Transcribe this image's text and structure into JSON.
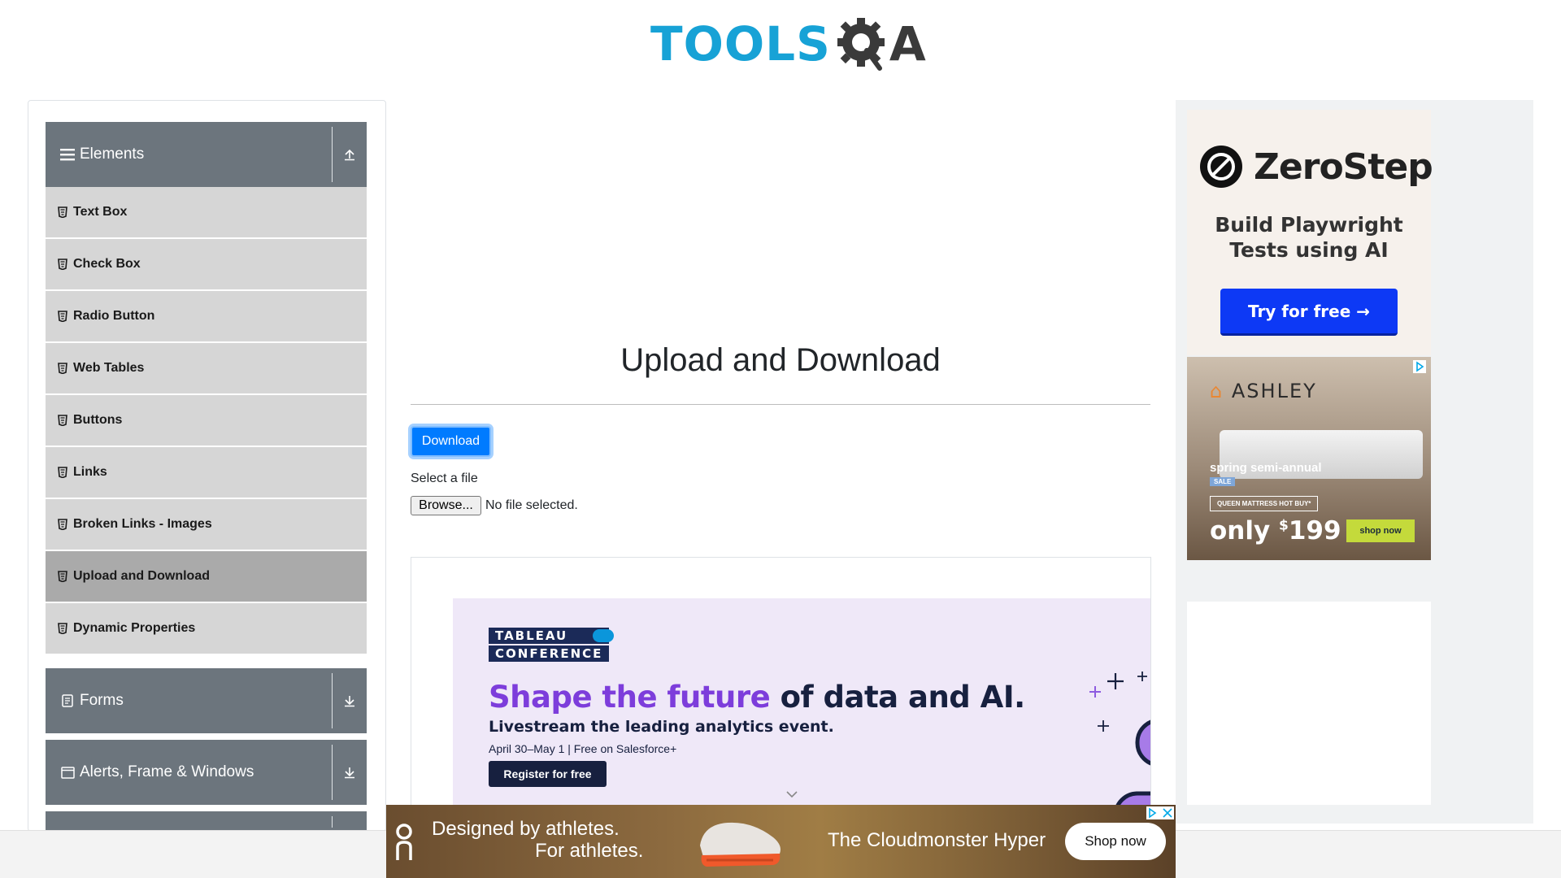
{
  "header": {
    "logo_left": "TOOLS",
    "logo_right": "A"
  },
  "sidebar": {
    "groups": [
      {
        "label": "Elements",
        "expanded": true,
        "icon": "hamburger-icon",
        "arrow": "collapse-icon"
      },
      {
        "label": "Forms",
        "expanded": false,
        "icon": "form-icon",
        "arrow": "expand-icon"
      },
      {
        "label": "Alerts, Frame & Windows",
        "expanded": false,
        "icon": "window-icon",
        "arrow": "expand-icon"
      }
    ],
    "items": [
      {
        "label": "Text Box",
        "active": false
      },
      {
        "label": "Check Box",
        "active": false
      },
      {
        "label": "Radio Button",
        "active": false
      },
      {
        "label": "Web Tables",
        "active": false
      },
      {
        "label": "Buttons",
        "active": false
      },
      {
        "label": "Links",
        "active": false
      },
      {
        "label": "Broken Links - Images",
        "active": false
      },
      {
        "label": "Upload and Download",
        "active": true
      },
      {
        "label": "Dynamic Properties",
        "active": false
      }
    ]
  },
  "main": {
    "title": "Upload and Download",
    "download_label": "Download",
    "select_label": "Select a file",
    "browse_label": "Browse...",
    "file_status": "No file selected."
  },
  "ads": {
    "tableau": {
      "badge_line1": "TABLEAU",
      "badge_line2": "CONFERENCE",
      "headline_purple": "Shape the future",
      "headline_dark": " of data and AI.",
      "sub": "Livestream the leading analytics event.",
      "date": "April 30–May 1 | Free on Salesforce+",
      "cta": "Register for free"
    },
    "zerostep": {
      "name": "ZeroStep",
      "line1": "Build Playwright",
      "line2": "Tests using AI",
      "cta": "Try for free →"
    },
    "ashley": {
      "brand": "ASHLEY",
      "sale": "spring semi-annual",
      "sale_tag": "SALE",
      "hot_buy": "QUEEN MATTRESS HOT BUY*",
      "price_prefix": "only ",
      "price_currency": "$",
      "price_value": "199",
      "cta": "shop now"
    },
    "on": {
      "line1": "Designed by athletes.",
      "line2": "For athletes.",
      "product": "The Cloudmonster Hyper",
      "cta": "Shop now"
    }
  },
  "colors": {
    "brand_blue": "#17a2d6",
    "group_header": "#6c757d",
    "menu_item": "#d6d6d6",
    "menu_active": "#aaaaaa",
    "primary": "#007bff"
  }
}
